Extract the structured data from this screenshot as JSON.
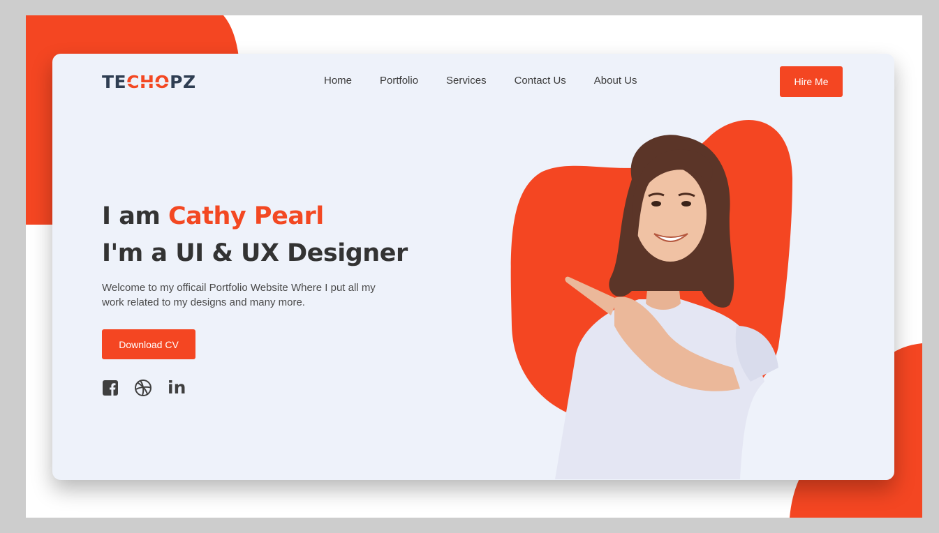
{
  "brand": {
    "logo_prefix": "TE",
    "logo_accent": "CHO",
    "logo_suffix": "PZ",
    "accent_color": "#f34822",
    "dark_color": "#2f3e52"
  },
  "nav": {
    "items": [
      {
        "label": "Home"
      },
      {
        "label": "Portfolio"
      },
      {
        "label": "Services"
      },
      {
        "label": "Contact Us"
      },
      {
        "label": "About Us"
      }
    ]
  },
  "header": {
    "hire_label": "Hire Me"
  },
  "hero": {
    "line1_prefix": "I am ",
    "name": "Cathy Pearl",
    "line2": "I'm a UI & UX Designer",
    "intro": "Welcome to my officail Portfolio Website Where I put all my work related to my designs and many more.",
    "cta_label": "Download CV"
  },
  "socials": [
    {
      "icon": "facebook-icon"
    },
    {
      "icon": "dribbble-icon"
    },
    {
      "icon": "linkedin-icon",
      "text": "in"
    }
  ]
}
